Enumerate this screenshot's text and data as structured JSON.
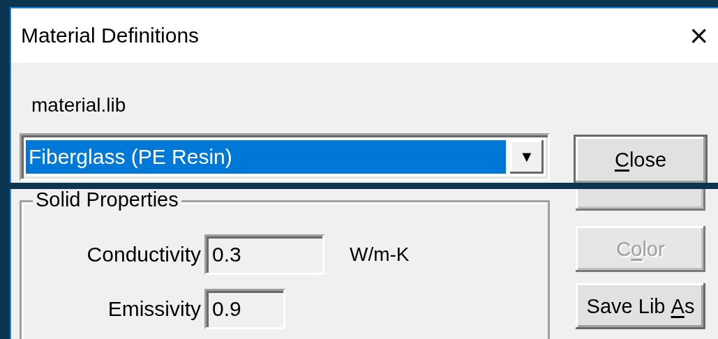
{
  "window": {
    "title": "Material Definitions",
    "close": "×"
  },
  "library": {
    "label": "material.lib"
  },
  "material_combo": {
    "value": "Fiberglass (PE Resin)",
    "highlighted": true,
    "arrow": "▼"
  },
  "buttons": [
    {
      "mnemonic": "C",
      "after": "lose",
      "disabled": false
    },
    {
      "kind": "covered"
    },
    {
      "before": "C",
      "mnemonic": "o",
      "after": "lor",
      "disabled": true
    },
    {
      "before": "Save Lib ",
      "mnemonic": "A",
      "after": "s",
      "disabled": false
    }
  ],
  "solid_properties": {
    "title": "Solid Properties",
    "fields": [
      {
        "label": "Conductivity",
        "value": "0.3",
        "unit": "W/m-K"
      },
      {
        "label": "Emissivity",
        "value": "0.9"
      }
    ]
  }
}
